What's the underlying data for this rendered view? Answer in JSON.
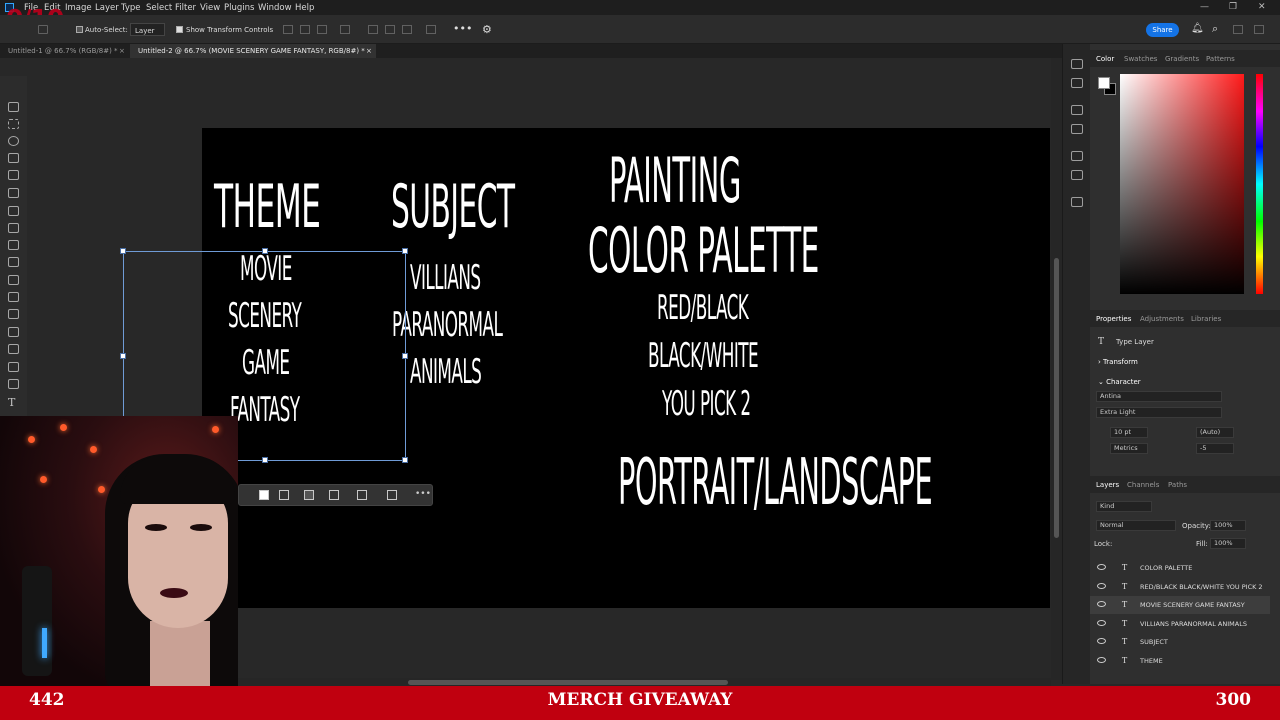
{
  "menubar": {
    "items": [
      "File",
      "Edit",
      "Image",
      "Layer",
      "Type",
      "Select",
      "Filter",
      "View",
      "Plugins",
      "Window",
      "Help"
    ]
  },
  "options": {
    "auto_select_label": "Auto-Select:",
    "auto_select_value": "Layer",
    "transform_label": "Show Transform Controls",
    "share_label": "Share"
  },
  "tabs": [
    {
      "label": "Untitled-1 @ 66.7% (RGB/8#) *"
    },
    {
      "label": "Untitled-2 @ 66.7% (MOVIE SCENERY GAME FANTASY, RGB/8#) *"
    }
  ],
  "canvas": {
    "theme_heading": "THEME",
    "subject_heading": "SUBJECT",
    "painting_heading": "PAINTING",
    "palette_heading": "COLOR PALETTE",
    "orientation_heading": "PORTRAIT/LANDSCAPE",
    "theme_items": [
      "MOVIE",
      "SCENERY",
      "GAME",
      "FANTASY"
    ],
    "subject_items": [
      "VILLIANS",
      "PARANORMAL",
      "ANIMALS"
    ],
    "palette_items": [
      "RED/BLACK",
      "BLACK/WHITE",
      "YOU PICK 2"
    ]
  },
  "panels": {
    "color_tabs": [
      "Color",
      "Swatches",
      "Gradients",
      "Patterns"
    ],
    "properties_tabs": [
      "Properties",
      "Adjustments",
      "Libraries"
    ],
    "type_layer_label": "Type Layer",
    "transform_label": "Transform",
    "character_label": "Character",
    "font_family": "Antina",
    "font_style": "Extra Light",
    "font_size": "10 pt",
    "leading": "(Auto)",
    "kerning": "Metrics",
    "tracking": "-5",
    "layers_tabs": [
      "Layers",
      "Channels",
      "Paths"
    ],
    "kind_label": "Kind",
    "blend_mode": "Normal",
    "opacity_label": "Opacity:",
    "opacity_value": "100%",
    "lock_label": "Lock:",
    "fill_label": "Fill:",
    "fill_value": "100%",
    "layers": [
      {
        "name": "COLOR PALETTE",
        "selected": false
      },
      {
        "name": "RED/BLACK BLACK/WHITE YOU PICK 2",
        "selected": false
      },
      {
        "name": "MOVIE SCENERY GAME FANTASY",
        "selected": true
      },
      {
        "name": "VILLIANS PARANORMAL ANIMALS",
        "selected": false
      },
      {
        "name": "SUBJECT",
        "selected": false
      },
      {
        "name": "THEME",
        "selected": false
      }
    ]
  },
  "overlay": {
    "score": "0/10",
    "banner_left": "442",
    "banner_center": "MERCH GIVEAWAY",
    "banner_right": "300"
  }
}
